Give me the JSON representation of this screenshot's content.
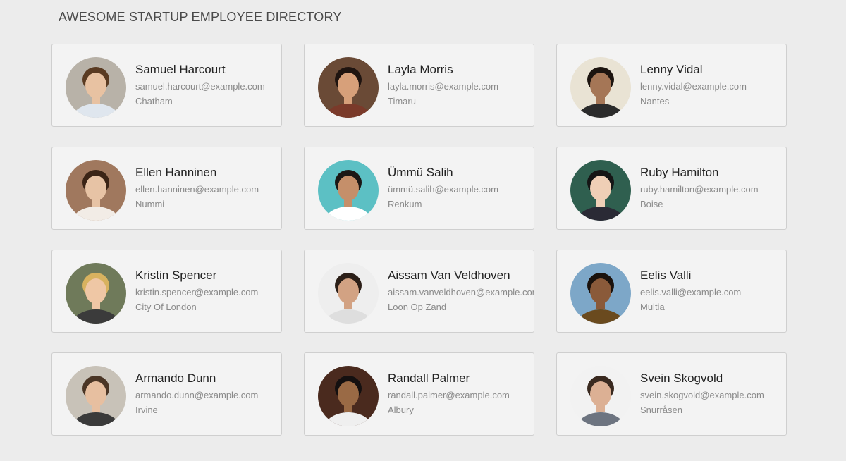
{
  "header": {
    "title": "AWESOME STARTUP EMPLOYEE DIRECTORY"
  },
  "employees": [
    {
      "name": "Samuel Harcourt",
      "email": "samuel.harcourt@example.com",
      "city": "Chatham",
      "avatar": {
        "bg": "#b8b2a8",
        "skin": "#e8c2a2",
        "hair": "#5a3b22",
        "shirt": "#dfe6ee"
      }
    },
    {
      "name": "Layla Morris",
      "email": "layla.morris@example.com",
      "city": "Timaru",
      "avatar": {
        "bg": "#6a4a36",
        "skin": "#d7a07a",
        "hair": "#1f1410",
        "shirt": "#7a3a2a"
      }
    },
    {
      "name": "Lenny Vidal",
      "email": "lenny.vidal@example.com",
      "city": "Nantes",
      "avatar": {
        "bg": "#e9e3d4",
        "skin": "#a57656",
        "hair": "#1c140f",
        "shirt": "#2b2b2b"
      }
    },
    {
      "name": "Ellen Hanninen",
      "email": "ellen.hanninen@example.com",
      "city": "Nummi",
      "avatar": {
        "bg": "#a0785e",
        "skin": "#e7c3a5",
        "hair": "#3b2416",
        "shirt": "#f2ece6"
      }
    },
    {
      "name": "Ümmü Salih",
      "email": "ümmü.salih@example.com",
      "city": "Renkum",
      "avatar": {
        "bg": "#5cc0c4",
        "skin": "#c58f6a",
        "hair": "#1b1715",
        "shirt": "#ffffff"
      }
    },
    {
      "name": "Ruby Hamilton",
      "email": "ruby.hamilton@example.com",
      "city": "Boise",
      "avatar": {
        "bg": "#2f5f4f",
        "skin": "#efcfb6",
        "hair": "#151515",
        "shirt": "#2a2a35"
      }
    },
    {
      "name": "Kristin Spencer",
      "email": "kristin.spencer@example.com",
      "city": "City Of London",
      "avatar": {
        "bg": "#6f7a5a",
        "skin": "#efc7a5",
        "hair": "#d8b25f",
        "shirt": "#3b3b3b"
      }
    },
    {
      "name": "Aissam Van Veldhoven",
      "email": "aissam.vanveldhoven@example.com",
      "city": "Loon Op Zand",
      "avatar": {
        "bg": "#eeeeee",
        "skin": "#d2a283",
        "hair": "#2b1f18",
        "shirt": "#dedede"
      }
    },
    {
      "name": "Eelis Valli",
      "email": "eelis.valli@example.com",
      "city": "Multia",
      "avatar": {
        "bg": "#7da7c8",
        "skin": "#8a5a3a",
        "hair": "#1a120d",
        "shirt": "#6a4a1e"
      }
    },
    {
      "name": "Armando Dunn",
      "email": "armando.dunn@example.com",
      "city": "Irvine",
      "avatar": {
        "bg": "#c8c2b8",
        "skin": "#e7bfa0",
        "hair": "#4a3525",
        "shirt": "#3a3a3a"
      }
    },
    {
      "name": "Randall Palmer",
      "email": "randall.palmer@example.com",
      "city": "Albury",
      "avatar": {
        "bg": "#4a2a1e",
        "skin": "#9a6a45",
        "hair": "#141010",
        "shirt": "#efefef"
      }
    },
    {
      "name": "Svein Skogvold",
      "email": "svein.skogvold@example.com",
      "city": "Snurråsen",
      "avatar": {
        "bg": "#f2f2f2",
        "skin": "#dcb094",
        "hair": "#3a2a20",
        "shirt": "#6d7480"
      }
    }
  ]
}
